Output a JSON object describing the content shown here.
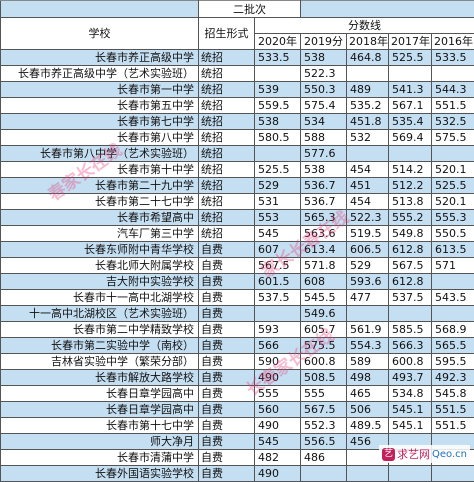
{
  "section_title": "二批次",
  "headers": {
    "school": "学校",
    "admission_type": "招生形式",
    "score_group": "分数线",
    "years": [
      "2020年",
      "2019分",
      "2018年",
      "2017年",
      "2016年"
    ]
  },
  "rows": [
    {
      "school": "长春市养正高级中学",
      "type": "统招",
      "scores": [
        "533.5",
        "538",
        "464.8",
        "525.5",
        "533.5"
      ]
    },
    {
      "school": "长春市养正高级中学（艺术实验班）",
      "type": "统招",
      "scores": [
        "",
        "522.3",
        "",
        "",
        ""
      ]
    },
    {
      "school": "长春市第一中学",
      "type": "统招",
      "scores": [
        "539",
        "550.3",
        "489",
        "541.3",
        "544.3"
      ]
    },
    {
      "school": "长春市第五中学",
      "type": "统招",
      "scores": [
        "559.5",
        "575.4",
        "535.2",
        "567.1",
        "551.5"
      ]
    },
    {
      "school": "长春市第七中学",
      "type": "统招",
      "scores": [
        "538",
        "534",
        "451.8",
        "535.4",
        "532.5"
      ]
    },
    {
      "school": "长春市第八中学",
      "type": "统招",
      "scores": [
        "580.5",
        "588",
        "532",
        "569.4",
        "575.5"
      ]
    },
    {
      "school": "长春市第八中学（艺术实验班）",
      "type": "统招",
      "scores": [
        "",
        "577.6",
        "",
        "",
        ""
      ]
    },
    {
      "school": "长春市第十中学",
      "type": "统招",
      "scores": [
        "525.5",
        "538",
        "454",
        "514.2",
        "520.1"
      ]
    },
    {
      "school": "长春市第二十九中学",
      "type": "统招",
      "scores": [
        "529",
        "536.7",
        "451",
        "512.2",
        "525.5"
      ]
    },
    {
      "school": "长春市第二十七中学",
      "type": "统招",
      "scores": [
        "531",
        "536.7",
        "454",
        "513.8",
        "520.1"
      ]
    },
    {
      "school": "长春市希望高中",
      "type": "统招",
      "scores": [
        "553",
        "565.3",
        "522.3",
        "555.2",
        "555.3"
      ]
    },
    {
      "school": "汽车厂第三中学",
      "type": "统招",
      "scores": [
        "545",
        "563.6",
        "519.5",
        "549.8",
        "550.5"
      ]
    },
    {
      "school": "长春东师附中青华学校",
      "type": "自费",
      "scores": [
        "607",
        "613.4",
        "606.5",
        "612.8",
        "613.5"
      ]
    },
    {
      "school": "长春北师大附属学校",
      "type": "自费",
      "scores": [
        "567.5",
        "571.8",
        "529",
        "567.5",
        "571"
      ]
    },
    {
      "school": "吉大附中实验学校",
      "type": "自费",
      "scores": [
        "601.5",
        "608",
        "593.6",
        "612.8",
        ""
      ]
    },
    {
      "school": "长春市十一高中北湖学校",
      "type": "自费",
      "scores": [
        "537.5",
        "545.5",
        "477",
        "537.5",
        "543.5"
      ]
    },
    {
      "school": "十一高中北湖校区（艺术实验班）",
      "type": "自费",
      "scores": [
        "",
        "549.6",
        "",
        "",
        ""
      ]
    },
    {
      "school": "长春市第二中学精致学校",
      "type": "自费",
      "scores": [
        "593",
        "605.7",
        "561.9",
        "585.5",
        "568.9"
      ]
    },
    {
      "school": "长春市第二实验中学（南校）",
      "type": "自费",
      "scores": [
        "566",
        "575.5",
        "554.3",
        "566.3",
        "565.5"
      ]
    },
    {
      "school": "吉林省实验中学（繁荣分部）",
      "type": "自费",
      "scores": [
        "590",
        "600.8",
        "589",
        "600.8",
        "595.5"
      ]
    },
    {
      "school": "长春市解放大路学校",
      "type": "自费",
      "scores": [
        "490",
        "508.5",
        "498",
        "493.7",
        "492.3"
      ]
    },
    {
      "school": "长春日章学园高中",
      "type": "自费",
      "scores": [
        "555",
        "555",
        "465",
        "534.8",
        "545.8"
      ]
    },
    {
      "school": "长春日章学园高中",
      "type": "自费",
      "scores": [
        "560",
        "567.5",
        "506",
        "545.1",
        "551.5"
      ]
    },
    {
      "school": "长春市第十七中学",
      "type": "自费",
      "scores": [
        "490",
        "552.3",
        "489.5",
        "545.1",
        "551.5"
      ]
    },
    {
      "school": "师大净月",
      "type": "自费",
      "scores": [
        "545",
        "556.5",
        "456",
        "",
        ""
      ]
    },
    {
      "school": "长春市清蒲中学",
      "type": "自费",
      "scores": [
        "482",
        "486",
        "",
        "",
        ""
      ]
    },
    {
      "school": "长春外国语实验学校",
      "type": "自费",
      "scores": [
        "490",
        "",
        "",
        "",
        ""
      ]
    }
  ],
  "watermarks": [
    "春家长在线",
    "家长长春在线",
    "长春家长在线"
  ],
  "logo": {
    "mark": "艺",
    "text": "求艺网",
    "site": "Qeo.cn"
  },
  "colors": {
    "row_fill": "#c5dff2",
    "watermark": "#e63c78",
    "logo": "#c21f5b"
  }
}
